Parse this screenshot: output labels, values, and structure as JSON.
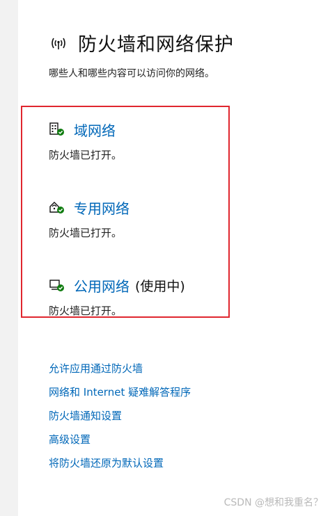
{
  "header": {
    "title": "防火墙和网络保护",
    "icon": "wifi-antenna-icon"
  },
  "subtitle": "哪些人和哪些内容可以访问你的网络。",
  "networks": [
    {
      "name": "域网络",
      "active_label": "",
      "status": "防火墙已打开。",
      "icon": "domain-network-icon"
    },
    {
      "name": "专用网络",
      "active_label": "",
      "status": "防火墙已打开。",
      "icon": "private-network-icon"
    },
    {
      "name": "公用网络",
      "active_label": "(使用中)",
      "status": "防火墙已打开。",
      "icon": "public-network-icon"
    }
  ],
  "links": [
    "允许应用通过防火墙",
    "网络和 Internet 疑难解答程序",
    "防火墙通知设置",
    "高级设置",
    "将防火墙还原为默认设置"
  ],
  "watermark": "CSDN @想和我重名？",
  "colors": {
    "link": "#0067b8",
    "highlight_border": "#e0262e",
    "check_green": "#107c10"
  }
}
